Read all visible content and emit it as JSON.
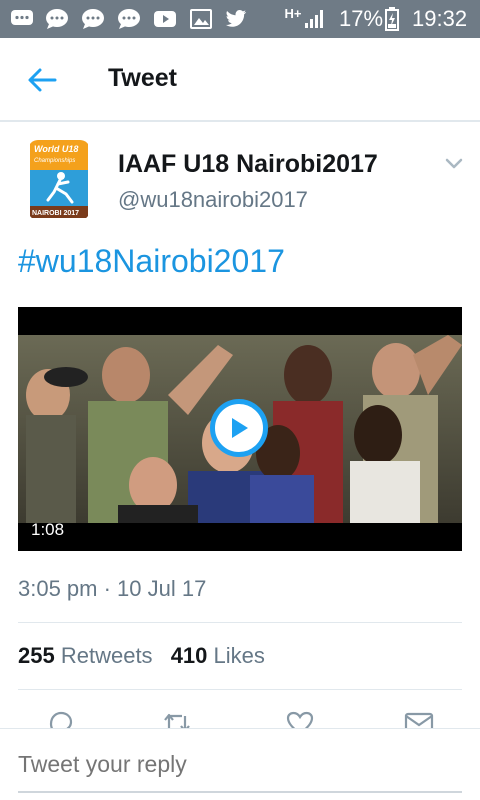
{
  "status_bar": {
    "icons": [
      "messages-icon",
      "chat-icon",
      "chat-icon",
      "chat-icon",
      "youtube-icon",
      "gallery-icon",
      "twitter-icon",
      "network-hplus-icon",
      "signal-icon",
      "battery-icon"
    ],
    "network": "H+",
    "battery": "17%",
    "time": "19:32"
  },
  "app_bar": {
    "title": "Tweet",
    "back_icon": "arrow-left-icon"
  },
  "tweet": {
    "author": {
      "name": "IAAF U18 Nairobi2017",
      "handle": "@wu18nairobi2017",
      "avatar_text_top": "World U18",
      "avatar_text_sub": "Championships",
      "avatar_text_bottom": "NAIROBI 2017"
    },
    "text": "#wu18Nairobi2017",
    "media": {
      "type": "video",
      "duration": "1:08",
      "play_icon": "play-icon"
    },
    "timestamp": "3:05 pm · 10 Jul 17",
    "retweets_count": "255",
    "retweets_label": "Retweets",
    "likes_count": "410",
    "likes_label": "Likes"
  },
  "actions": [
    "reply-icon",
    "retweet-icon",
    "like-icon",
    "direct-message-icon"
  ],
  "reply": {
    "placeholder": "Tweet your reply"
  },
  "colors": {
    "accent": "#1da1f2",
    "link": "#1b95e0",
    "status_bar": "#6f7b86",
    "secondary_text": "#657786"
  }
}
